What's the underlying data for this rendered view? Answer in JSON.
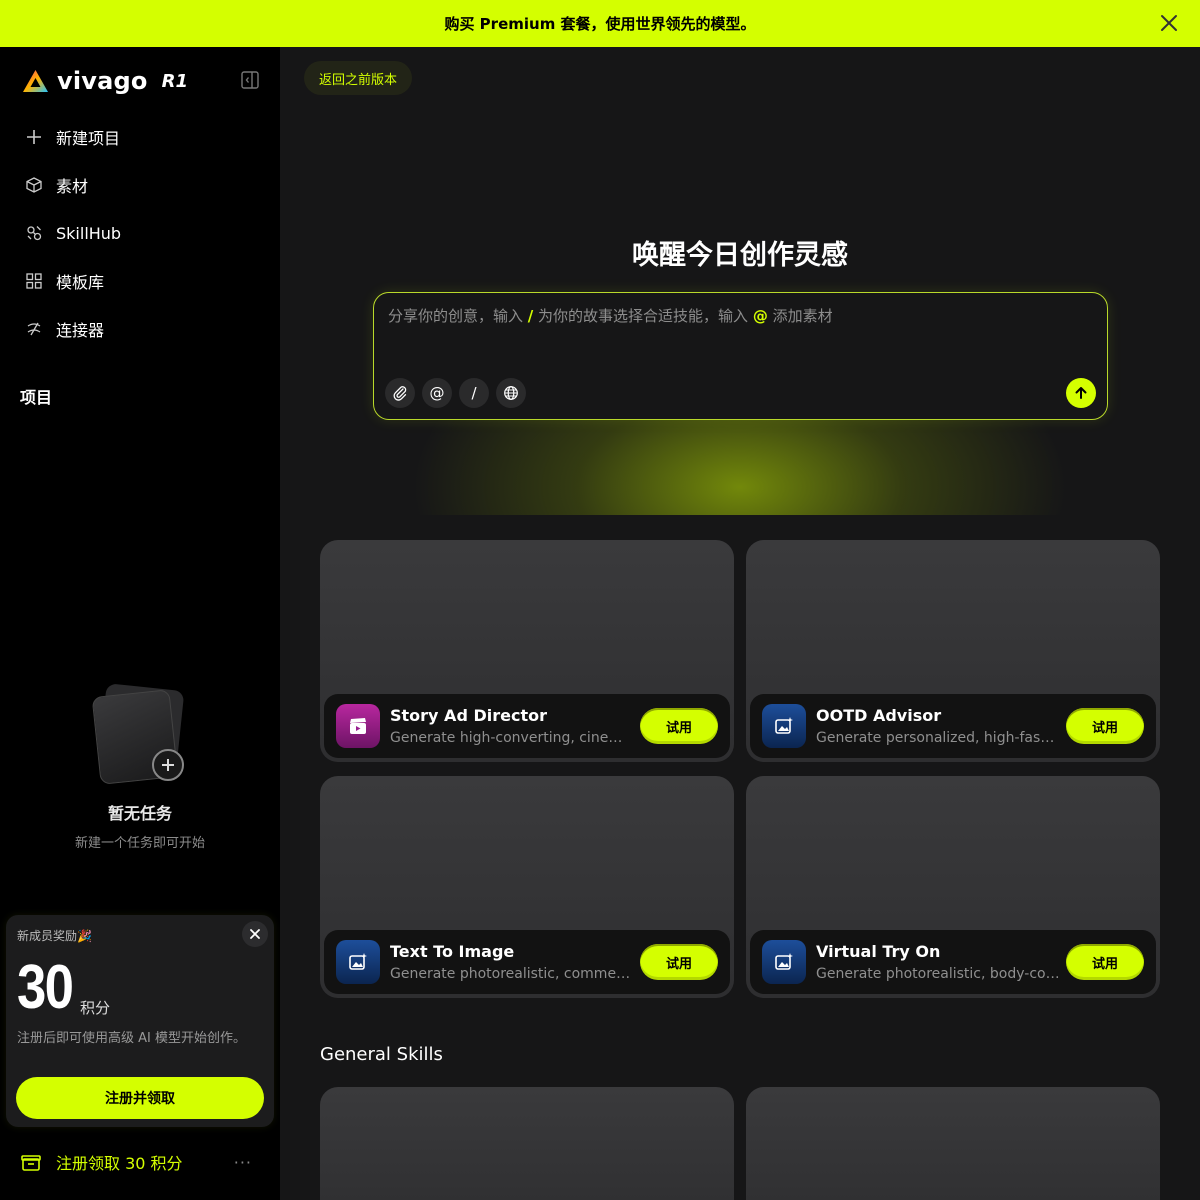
{
  "banner": {
    "text": "购买 Premium 套餐，使用世界领先的模型。",
    "close_icon": "close-icon"
  },
  "brand": {
    "name": "vivago",
    "model": "R1"
  },
  "sidebar": {
    "items": [
      {
        "label": "新建项目",
        "icon": "plus-icon"
      },
      {
        "label": "素材",
        "icon": "cube-icon"
      },
      {
        "label": "SkillHub",
        "icon": "skills-icon"
      },
      {
        "label": "模板库",
        "icon": "grid-icon"
      },
      {
        "label": "连接器",
        "icon": "link-icon"
      }
    ],
    "projects_title": "项目",
    "empty_title": "暂无任务",
    "empty_subtitle": "新建一个任务即可开始"
  },
  "promo": {
    "title": "新成员奖励🎉",
    "points": "30",
    "unit": "积分",
    "desc": "注册后即可使用高级 AI 模型开始创作。",
    "button": "注册并领取"
  },
  "bottom_bar": {
    "label": "注册领取 30 积分",
    "more": "···"
  },
  "main": {
    "back_button": "返回之前版本",
    "hero_title": "唤醒今日创作灵感",
    "prompt": {
      "ph_1": "分享你的创意，输入 ",
      "ph_slash": "/",
      "ph_2": " 为你的故事选择合适技能，输入 ",
      "ph_at": "@",
      "ph_3": " 添加素材",
      "tool_at": "@",
      "tool_slash": "/"
    },
    "cards": [
      {
        "name": "Story Ad Director",
        "desc": "Generate high-converting, cinematic ad stories",
        "button": "试用",
        "icon": "clapper-icon",
        "icon_color": "#9a1f8f"
      },
      {
        "name": "OOTD Advisor",
        "desc": "Generate personalized, high-fashion outfit looks",
        "button": "试用",
        "icon": "image-sparkle-icon",
        "icon_color": "#123b78"
      },
      {
        "name": "Text To Image",
        "desc": "Generate photorealistic, commercial images",
        "button": "试用",
        "icon": "image-sparkle-icon",
        "icon_color": "#123b78"
      },
      {
        "name": "Virtual Try On",
        "desc": "Generate photorealistic, body-conforming try-ons",
        "button": "试用",
        "icon": "image-sparkle-icon",
        "icon_color": "#123b78"
      }
    ],
    "general_skills_title": "General Skills"
  },
  "colors": {
    "accent": "#d4ff00",
    "bg_main": "#161617",
    "bg_sidebar": "#000000",
    "card": "#363638"
  }
}
